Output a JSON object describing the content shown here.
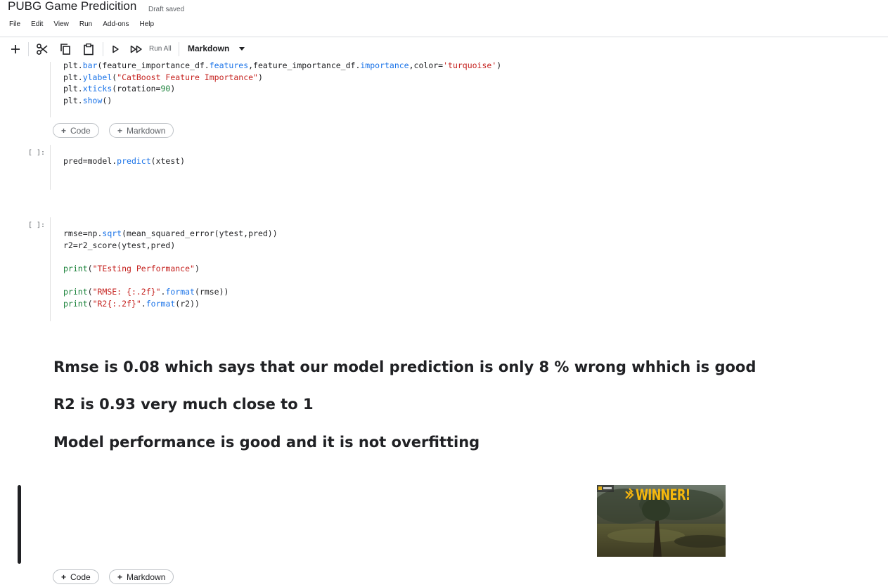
{
  "header": {
    "title": "PUBG Game Predicition",
    "status": "Draft saved",
    "menu": [
      "File",
      "Edit",
      "View",
      "Run",
      "Add-ons",
      "Help"
    ]
  },
  "toolbar": {
    "run_all_label": "Run All",
    "cell_type": "Markdown"
  },
  "cells": {
    "c1": {
      "lines": [
        "plt.bar(feature_importance_df.features,feature_importance_df.importance,color='turquoise')",
        "plt.ylabel(\"CatBoost Feature Importance\")",
        "plt.xticks(rotation=90)",
        "plt.show()"
      ]
    },
    "c2": {
      "prompt": "[ ]:",
      "lines": [
        "pred=model.predict(xtest)"
      ]
    },
    "c3": {
      "prompt": "[ ]:",
      "lines": [
        "rmse=np.sqrt(mean_squared_error(ytest,pred))",
        "r2=r2_score(ytest,pred)",
        "",
        "print(\"TEsting Performance\")",
        "",
        "print(\"RMSE: {:.2f}\".format(rmse))",
        "print(\"R2{:.2f}\".format(r2))"
      ]
    }
  },
  "add_buttons": {
    "code": "Code",
    "markdown": "Markdown"
  },
  "markdown": {
    "line1": "Rmse is 0.08 which says that our model prediction is only 8 % wrong whhich is good",
    "line2": "R2 is 0.93 very much close to 1",
    "line3": "Model performance is good and it is not overfitting"
  },
  "image": {
    "banner_text": "WINNER!"
  },
  "colors": {
    "cell_bg": "#f1f3f4",
    "string": "#c5221f",
    "keyword": "#1a73e8",
    "number": "#188038"
  }
}
